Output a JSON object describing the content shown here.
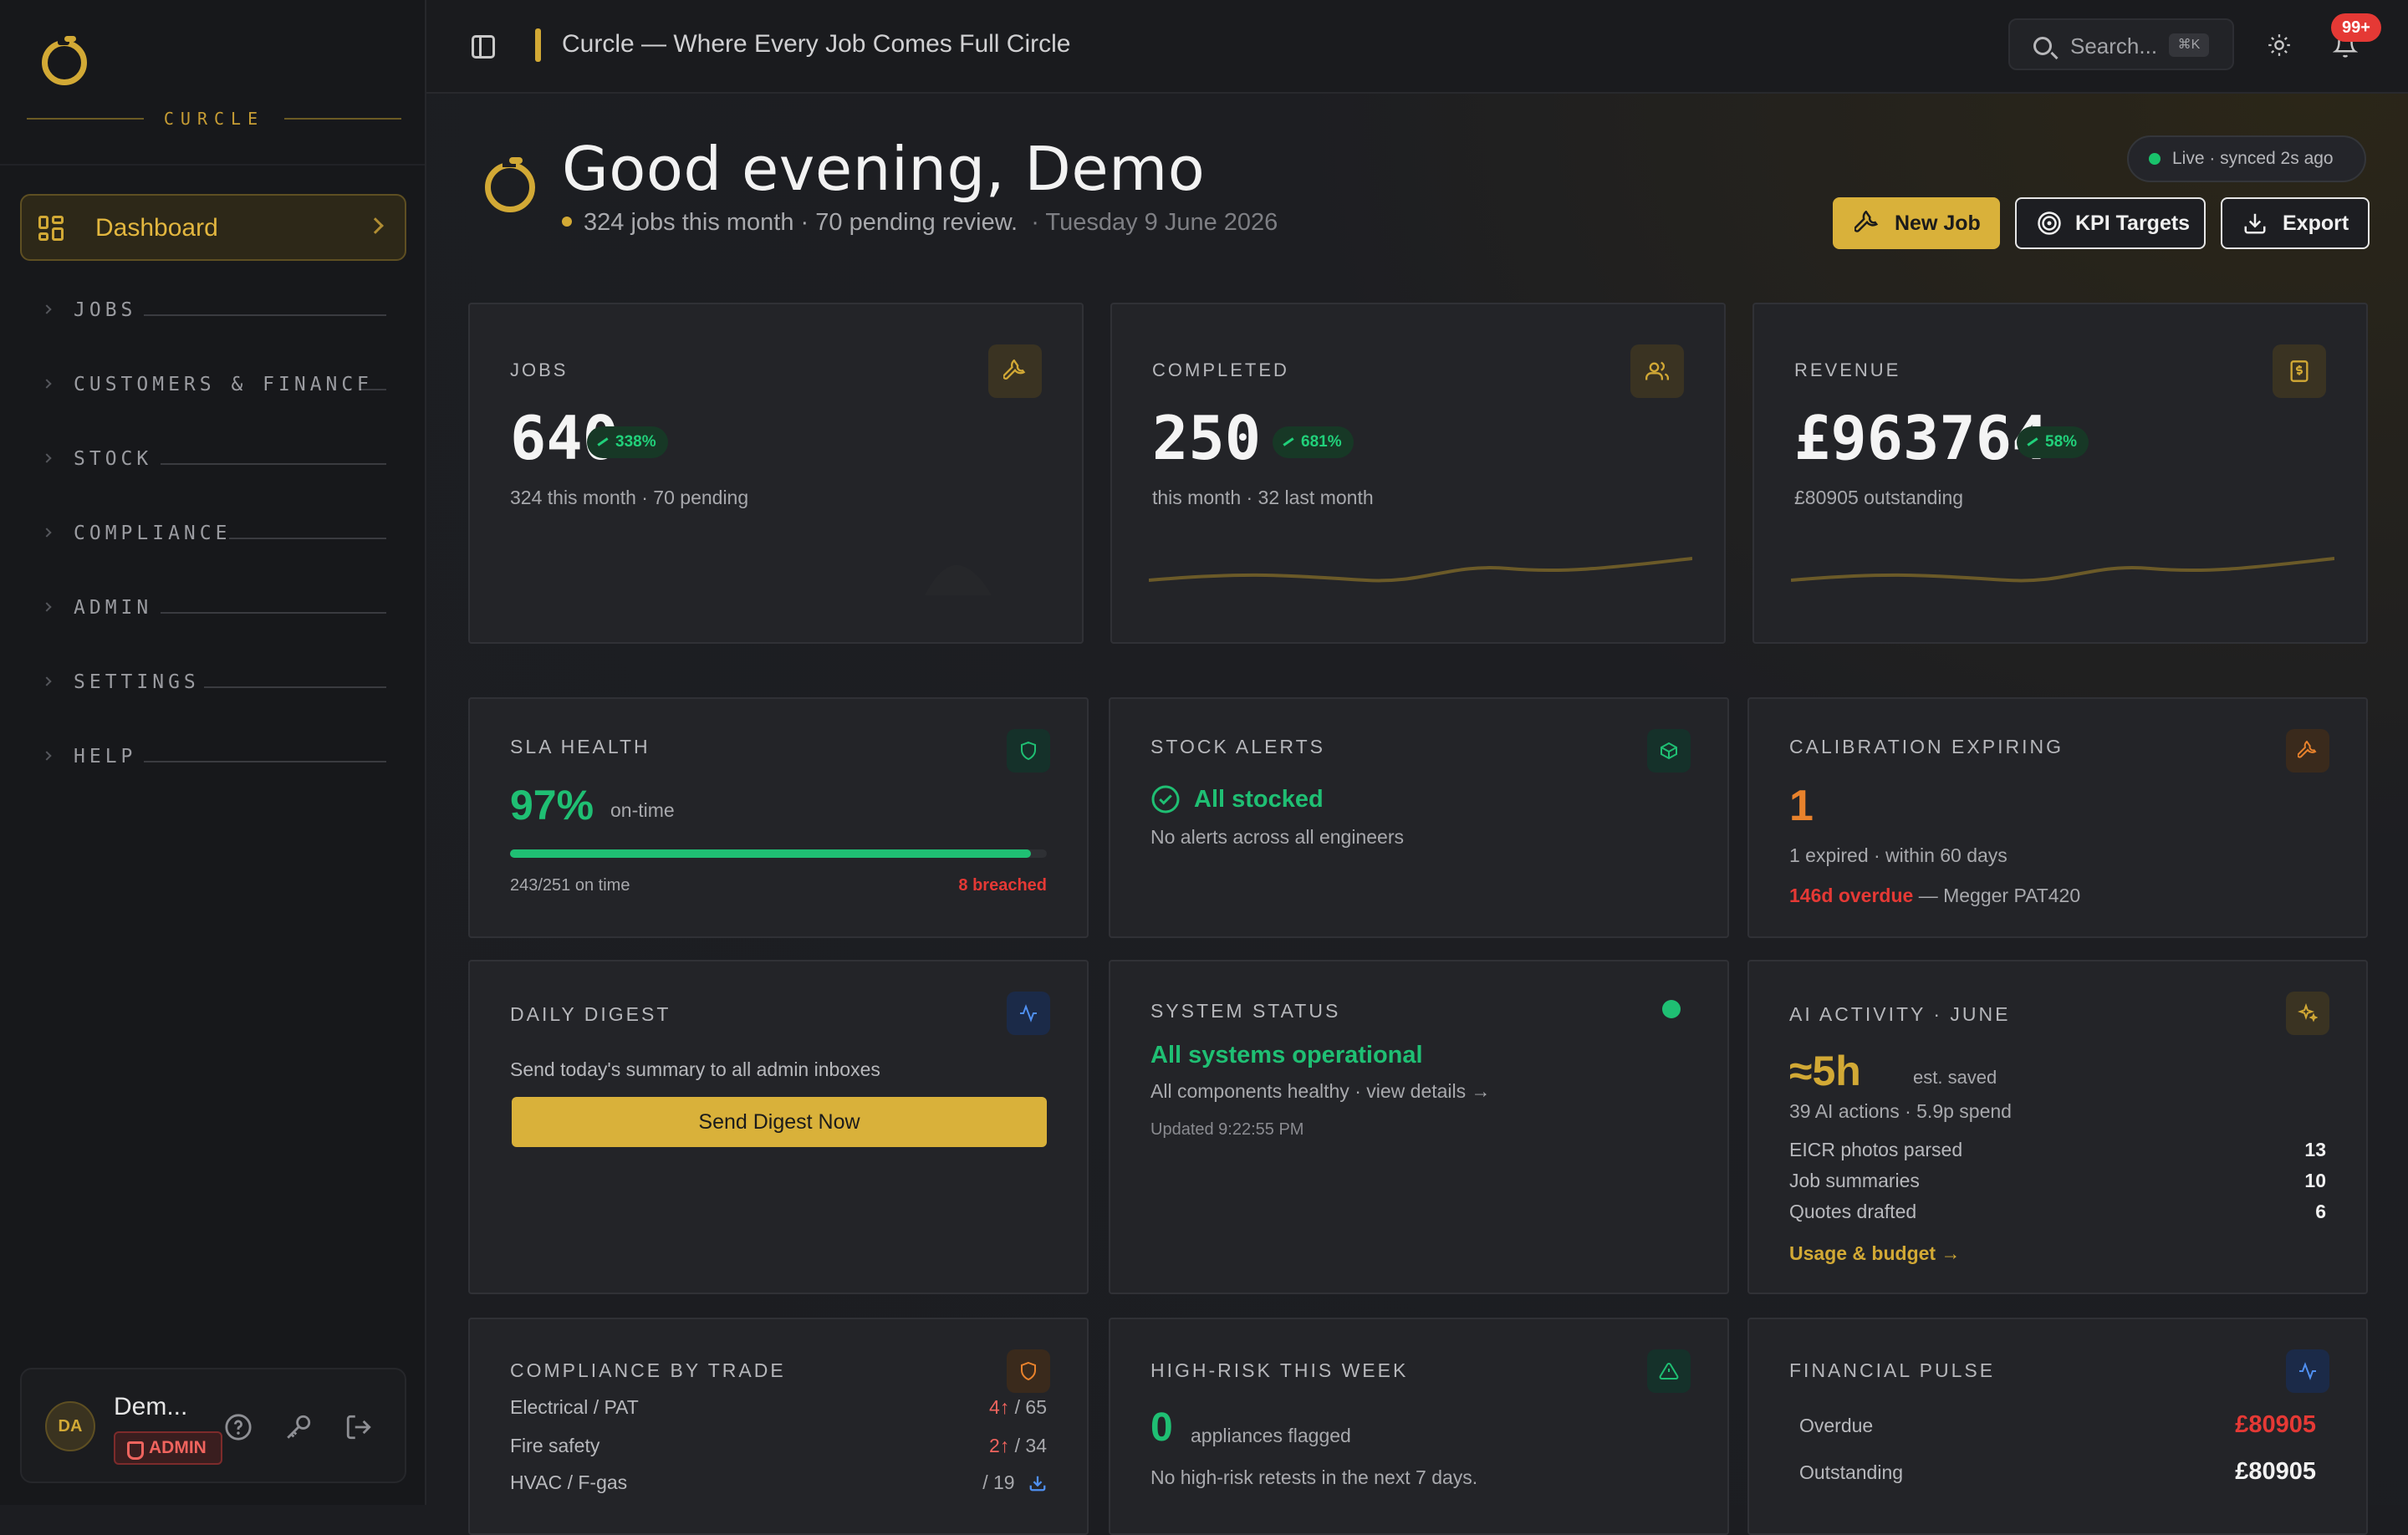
{
  "brand": {
    "name": "CURCLE"
  },
  "sidebar": {
    "dashboard_label": "Dashboard",
    "items": [
      {
        "label": "JOBS"
      },
      {
        "label": "CUSTOMERS & FINANCE"
      },
      {
        "label": "STOCK"
      },
      {
        "label": "COMPLIANCE"
      },
      {
        "label": "ADMIN"
      },
      {
        "label": "SETTINGS"
      },
      {
        "label": "HELP"
      }
    ],
    "user": {
      "initials": "DA",
      "name": "Dem...",
      "role": "ADMIN"
    }
  },
  "topbar": {
    "title": "Curcle — Where Every Job Comes Full Circle",
    "search_placeholder": "Search...",
    "search_shortcut": "⌘K",
    "notifications": "99+"
  },
  "header": {
    "greeting": "Good evening, Demo",
    "summary": "324 jobs this month · 70 pending review.",
    "date": "· Tuesday 9 June 2026",
    "live_status": "Live · synced 2s ago",
    "buttons": {
      "new_job": "New Job",
      "kpi_targets": "KPI Targets",
      "export": "Export"
    }
  },
  "kpis": [
    {
      "label": "JOBS",
      "value": "640",
      "change": "338%",
      "sub": "324 this month · 70 pending",
      "icon": "wrench-icon"
    },
    {
      "label": "COMPLETED",
      "value": "250",
      "change": "681%",
      "sub": "this month · 32 last month",
      "icon": "users-icon"
    },
    {
      "label": "REVENUE",
      "value": "£963764",
      "change": "58%",
      "sub": "£80905 outstanding",
      "icon": "dollar-doc-icon"
    }
  ],
  "sla": {
    "label": "SLA HEALTH",
    "percent": "97%",
    "suffix": "on-time",
    "progress": 0.97,
    "on_time": "243/251 on time",
    "breached": "8 breached"
  },
  "stock": {
    "label": "STOCK ALERTS",
    "status": "All stocked",
    "detail": "No alerts across all engineers"
  },
  "calibration": {
    "label": "CALIBRATION EXPIRING",
    "count": "1",
    "detail": "1 expired · within 60 days",
    "overdue": "146d overdue",
    "item": "— Megger PAT420"
  },
  "digest": {
    "label": "DAILY DIGEST",
    "text": "Send today's summary to all admin inboxes",
    "button": "Send Digest Now"
  },
  "system": {
    "label": "SYSTEM STATUS",
    "status": "All systems operational",
    "detail": "All components healthy · view details →",
    "updated": "Updated 9:22:55 PM"
  },
  "ai": {
    "label": "AI ACTIVITY · JUNE",
    "saved": "≈5h",
    "saved_suffix": "est. saved",
    "summary": "39 AI actions · 5.9p spend",
    "rows": [
      {
        "name": "EICR photos parsed",
        "value": "13"
      },
      {
        "name": "Job summaries",
        "value": "10"
      },
      {
        "name": "Quotes drafted",
        "value": "6"
      }
    ],
    "link": "Usage & budget →"
  },
  "compliance": {
    "label": "COMPLIANCE BY TRADE",
    "rows": [
      {
        "name": "Electrical / PAT",
        "flag": "4↑",
        "total": "/ 65"
      },
      {
        "name": "Fire safety",
        "flag": "2↑",
        "total": "/ 34"
      },
      {
        "name": "HVAC / F-gas",
        "flag": "",
        "total": "/ 19"
      }
    ]
  },
  "highrisk": {
    "label": "HIGH-RISK THIS WEEK",
    "count": "0",
    "suffix": "appliances flagged",
    "detail": "No high-risk retests in the next 7 days."
  },
  "financial": {
    "label": "FINANCIAL PULSE",
    "rows": [
      {
        "name": "Overdue",
        "value": "£80905"
      },
      {
        "name": "Outstanding",
        "value": "£80905"
      }
    ]
  },
  "colors": {
    "accent": "#d2a935",
    "green": "#1fbf73",
    "red": "#e53935",
    "orange": "#e8822c"
  }
}
